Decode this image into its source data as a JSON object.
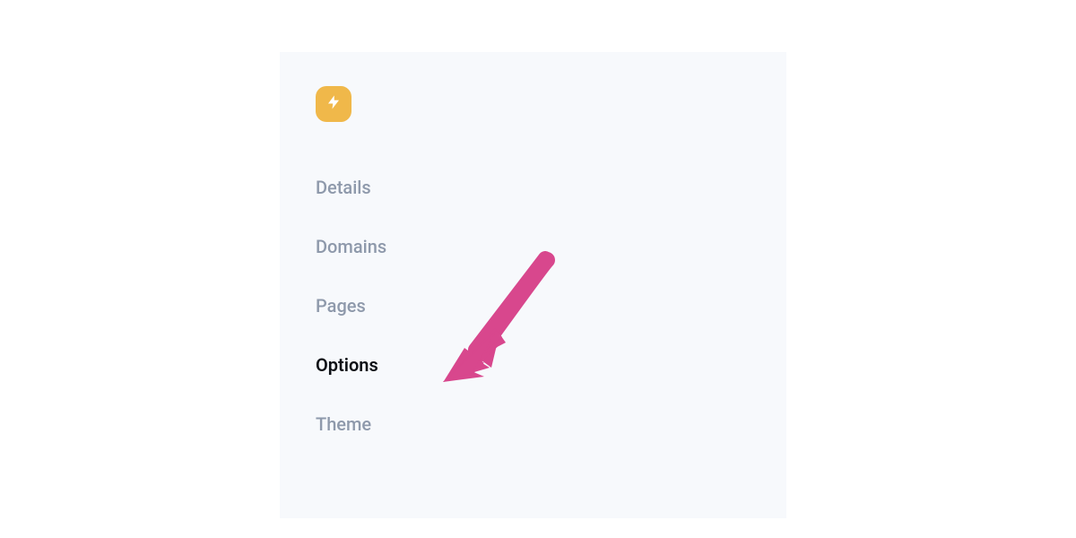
{
  "sidebar": {
    "logo_icon": "lightning-icon",
    "items": [
      {
        "label": "Details",
        "active": false
      },
      {
        "label": "Domains",
        "active": false
      },
      {
        "label": "Pages",
        "active": false
      },
      {
        "label": "Options",
        "active": true
      },
      {
        "label": "Theme",
        "active": false
      }
    ]
  },
  "annotation": {
    "type": "arrow",
    "color": "#d8478d",
    "pointing_to": "Options"
  }
}
